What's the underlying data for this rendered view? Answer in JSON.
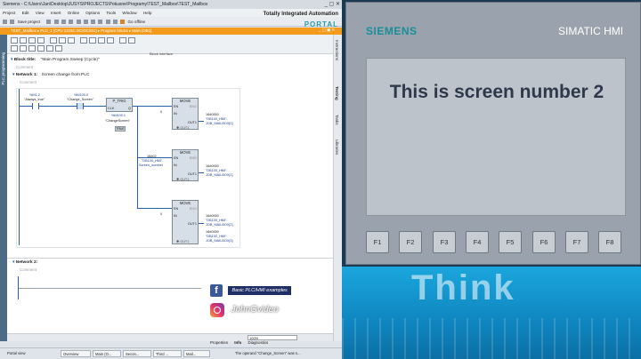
{
  "tia": {
    "title": "Siemens  -  C:\\Users\\Jan\\Desktop\\JUSYS\\PROJECTS\\Pokusne\\Programy\\TEST_Mailbox\\TEST_Mailbox",
    "window_controls": "_ ▢ ✕",
    "menu": [
      "Project",
      "Edit",
      "View",
      "Insert",
      "Online",
      "Options",
      "Tools",
      "Window",
      "Help"
    ],
    "toolbar": {
      "save": "Save project",
      "go_offline": "Go offline"
    },
    "brand_line1": "Totally Integrated Automation",
    "brand_line2": "PORTAL",
    "breadcrumb": "TEST_Mailbox  ▸  PLC_1 [CPU 1215C DC/DC/DC]  ▸  Program blocks  ▸  Main [OB1]",
    "breadcrumb_controls": "_ ▢ ▣ ✕",
    "left_tab": "PLC programming",
    "right_tabs": [
      "Instructions",
      "Testing",
      "Tasks",
      "Libraries"
    ],
    "block_interface": "Block interface",
    "block_title": "Block title:",
    "block_title_text": "\"Main Program Sweep (Cycle)\"",
    "comment": "Comment",
    "network1": {
      "label": "Network 1:",
      "title": "Screen change from PLC",
      "comment": "Comment",
      "contact1_addr": "%M1.2",
      "contact1_name": "\"Always_true\"",
      "contact2_addr": "%M100.0",
      "contact2_name": "\"Change_Screen\"",
      "ptrig": "P_TRIG",
      "ptrig_clk": "CLK",
      "ptrig_q": "Q",
      "ptrig_addr": "%M100.1",
      "ptrig_name": "\"ChangeScreen\"",
      "ptrig_flag": "TRUE",
      "move": "MOVE",
      "en": "EN",
      "eno": "ENO",
      "in": "IN",
      "out": "OUT1",
      "out_star": "✱ OUT1",
      "in1_val": "0",
      "move1_out_val": "16#0000",
      "move1_out_name": "\"DB100_HMI\".",
      "move1_out_member": "JOB_MAILBOX[0]",
      "in2_val": "16#02",
      "in2_name": "\"DB100_HMI\".",
      "in2_member": "Screen_number",
      "move2_out_val": "16#0000",
      "move2_out_name": "\"DB100_HMI\".",
      "move2_out_member": "JOB_MAILBOX[1]",
      "in3_val": "0",
      "move3_out_val1": "16#0000",
      "move3_out_name1": "\"DB100_HMI\".",
      "move3_out_member1": "JOB_MAILBOX[2]",
      "move3_out_val2": "16#0000",
      "move3_out_name2": "\"DB100_HMI\".",
      "move3_out_member2": "JOB_MAILBOX[3]"
    },
    "network2": {
      "label": "Network 2:",
      "comment": "Comment"
    },
    "status": {
      "zoom": "100%",
      "properties": "Properties",
      "info": "Info",
      "diagnostics": "Diagnostics"
    },
    "taskbar": {
      "portal_view": "Portal view",
      "items": [
        "Overview",
        "Main (O...",
        "Secon...",
        "Third ...",
        "Mail...",
        "The operand \"Change_Screen\" was s..."
      ]
    }
  },
  "hmi": {
    "logo": "SIEMENS",
    "model": "SIMATIC HMI",
    "screen_text": "This is screen number 2",
    "fkeys": [
      "F1",
      "F2",
      "F3",
      "F4",
      "F5",
      "F6",
      "F7",
      "F8"
    ]
  },
  "overlay": {
    "wall_text": "Think",
    "fb_label": "Basic PLC/HMI examples",
    "ig_label": "JohnGvideo"
  }
}
